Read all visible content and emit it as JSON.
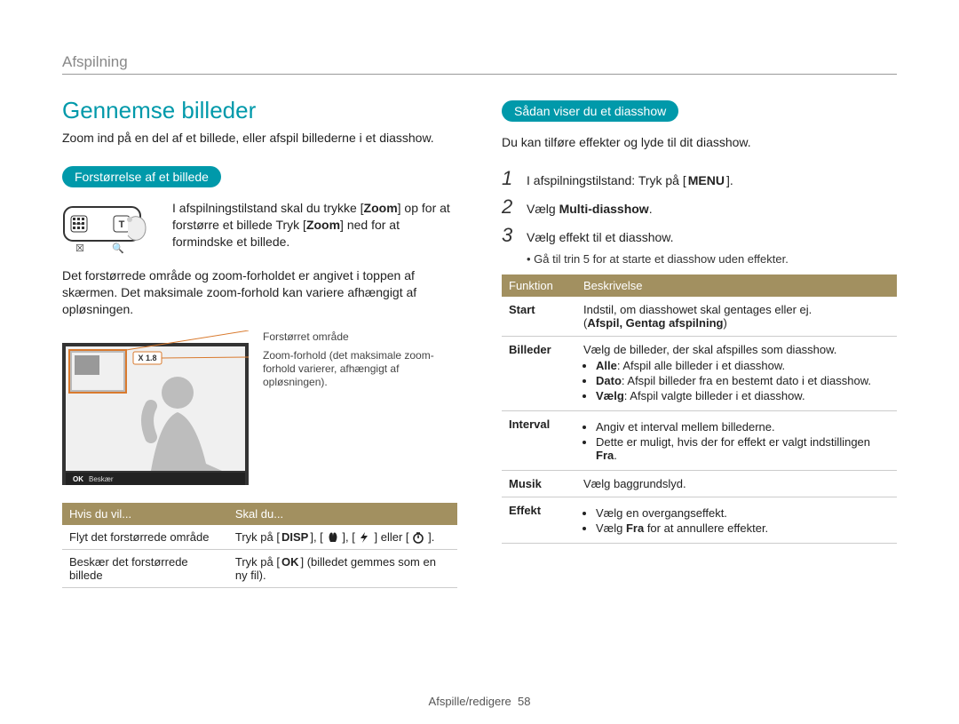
{
  "header": {
    "section": "Afspilning"
  },
  "left": {
    "title": "Gennemse billeder",
    "intro": "Zoom ind på en del af et billede, eller afspil billederne i et diasshow.",
    "pill1": "Forstørrelse af et billede",
    "zoomText": "I afspilningstilstand skal du trykke [Zoom] op for at forstørre et billede Tryk [Zoom] ned for at formindske et billede.",
    "zoomLabel1": "Zoom",
    "zoomLabel2": "Zoom",
    "para2": "Det forstørrede område og zoom-forholdet er angivet i toppen af skærmen. Det maksimale zoom-forhold kan variere afhængigt af opløsningen.",
    "screenshot": {
      "zoomBadge": "X 1.8",
      "okLabel": "Beskær",
      "anno1": "Forstørret område",
      "anno2": "Zoom-forhold (det maksimale zoom-forhold varierer, afhængigt af opløsningen)."
    },
    "table": {
      "h1": "Hvis du vil...",
      "h2": "Skal du...",
      "r1c1": "Flyt det forstørrede område",
      "r1c2_pre": "Tryk på [",
      "r1c2_disp": "DISP",
      "r1c2_mid1": "], [",
      "r1c2_mid2": "], [",
      "r1c2_mid3": "] eller [",
      "r1c2_end": "].",
      "r2c1": "Beskær det forstørrede billede",
      "r2c2_pre": "Tryk på [",
      "r2c2_post": "] (billedet gemmes som en ny fil)."
    }
  },
  "right": {
    "pill": "Sådan viser du et diasshow",
    "intro": "Du kan tilføre effekter og lyde til dit diasshow.",
    "steps": [
      {
        "n": "1",
        "pre": "I afspilningstilstand: Tryk på [",
        "key": "MENU",
        "post": "]."
      },
      {
        "n": "2",
        "pre": "Vælg ",
        "key": "Multi-diasshow",
        "post": "."
      },
      {
        "n": "3",
        "pre": "Vælg effekt til et diasshow.",
        "key": "",
        "post": ""
      }
    ],
    "substep": "Gå til trin 5 for at starte et diasshow uden effekter.",
    "table": {
      "h1": "Funktion",
      "h2": "Beskrivelse",
      "rows": [
        {
          "name": "Start",
          "desc_line1": "Indstil, om diasshowet skal gentages eller ej.",
          "desc_line2_pre": "(",
          "desc_line2_bold": "Afspil, Gentag afspilning",
          "desc_line2_post": ")"
        },
        {
          "name": "Billeder",
          "desc_line1": "Vælg de billeder, der skal afspilles som diasshow.",
          "bullets": [
            {
              "bold": "Alle",
              "text": ": Afspil alle billeder i et diasshow."
            },
            {
              "bold": "Dato",
              "text": ": Afspil billeder fra en bestemt dato i et diasshow."
            },
            {
              "bold": "Vælg",
              "text": ": Afspil valgte billeder i et diasshow."
            }
          ]
        },
        {
          "name": "Interval",
          "bullets_plain": [
            "Angiv et interval mellem billederne.",
            {
              "pre": "Dette er muligt, hvis der for effekt er valgt indstillingen ",
              "bold": "Fra",
              "post": "."
            }
          ]
        },
        {
          "name": "Musik",
          "desc_line1": "Vælg baggrundslyd."
        },
        {
          "name": "Effekt",
          "bullets_plain": [
            "Vælg en overgangseffekt.",
            {
              "pre": "Vælg ",
              "bold": "Fra",
              "post": " for at annullere effekter."
            }
          ]
        }
      ]
    }
  },
  "footer": {
    "section": "Afspille/redigere",
    "page": "58"
  }
}
